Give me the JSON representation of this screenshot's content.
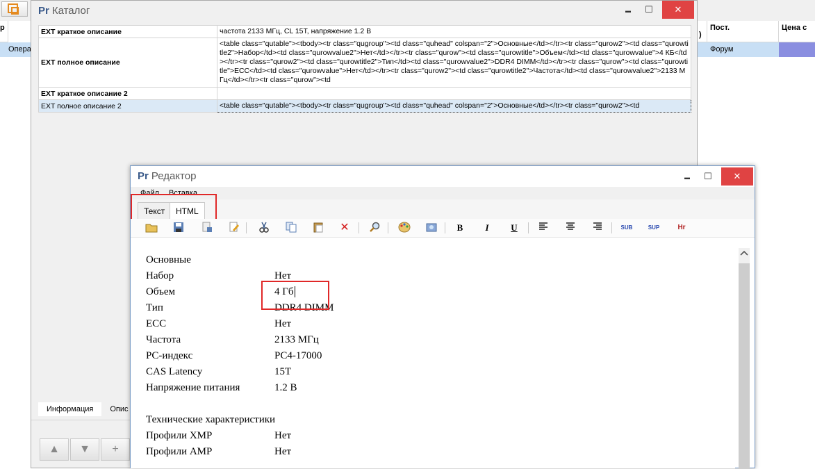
{
  "background": {
    "headers": [
      "Пост.",
      "Цена с"
    ],
    "header_partial": ")",
    "row": {
      "col_left_1": "р",
      "col_left_2": "Опера",
      "supplier": "Форум"
    }
  },
  "catalog": {
    "app_logo": "Pr",
    "title": "Каталог",
    "rows": [
      {
        "key": "EXT краткое описание",
        "value": "частота 2133 МГц, CL 15T, напряжение 1.2 В"
      },
      {
        "key": "EXT полное описание",
        "value": "<table class=\"qutable\"><tbody><tr class=\"qugroup\"><td class=\"quhead\" colspan=\"2\">Основные</td></tr><tr class=\"qurow2\"><td class=\"qurowtitle2\">Набор</td><td class=\"qurowvalue2\">Нет</td></tr><tr class=\"qurow\"><td class=\"qurowtitle\">Объем</td><td class=\"qurowvalue\">4 КБ</td></tr><tr class=\"qurow2\"><td class=\"qurowtitle2\">Тип</td><td class=\"qurowvalue2\">DDR4 DIMM</td></tr><tr class=\"qurow\"><td class=\"qurowtitle\">ECC</td><td class=\"qurowvalue\">Нет</td></tr><tr class=\"qurow2\"><td class=\"qurowtitle2\">Частота</td><td class=\"qurowvalue2\">2133 МГц</td></tr><tr class=\"qurow\"><td"
      },
      {
        "key": "EXT краткое описание 2",
        "value": ""
      },
      {
        "key": "EXT полное описание 2",
        "value": "<table class=\"qutable\"><tbody><tr class=\"qugroup\"><td class=\"quhead\" colspan=\"2\">Основные</td></tr><tr class=\"qurow2\"><td"
      }
    ],
    "tabs": [
      "Информация",
      "Опис"
    ],
    "nav_buttons": {
      "up": "▲",
      "down": "▼",
      "add": "+"
    }
  },
  "editor": {
    "app_logo": "Pr",
    "title": "Редактор",
    "menu": [
      "Файл",
      "Вставка"
    ],
    "tabs": [
      "Текст",
      "HTML"
    ],
    "active_tab": "HTML",
    "toolbar": {
      "bold": "B",
      "italic": "I",
      "underline": "U",
      "sub": "SUB",
      "sup": "SUP",
      "hr": "Hr"
    },
    "content": {
      "group1": "Основные",
      "rows1": [
        {
          "title": "Набор",
          "value": "Нет"
        },
        {
          "title": "Объем",
          "value": "4 Гб"
        },
        {
          "title": "Тип",
          "value": "DDR4 DIMM"
        },
        {
          "title": "ECC",
          "value": "Нет"
        },
        {
          "title": "Частота",
          "value": "2133 МГц"
        },
        {
          "title": "PC-индекс",
          "value": "PC4-17000"
        },
        {
          "title": "CAS Latency",
          "value": "15T"
        },
        {
          "title": "Напряжение питания",
          "value": "1.2 В"
        }
      ],
      "group2": "Технические характеристики",
      "rows2": [
        {
          "title": "Профили XMP",
          "value": "Нет"
        },
        {
          "title": "Профили AMP",
          "value": "Нет"
        }
      ]
    }
  },
  "window_buttons": {
    "minimize": "▬",
    "maximize": "☐",
    "close": "✕"
  },
  "colors": {
    "accent": "#3a5a8a",
    "highlight": "#e02828",
    "selection": "#dbe9f6",
    "row_highlight": "#c8dff5",
    "price_cell": "#8a8ee0"
  }
}
